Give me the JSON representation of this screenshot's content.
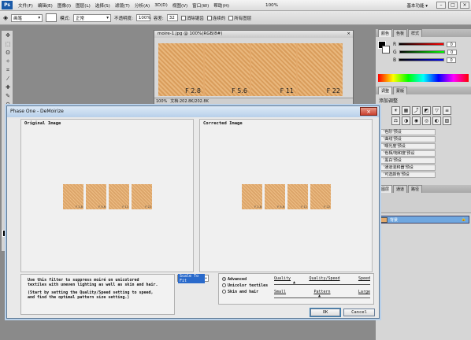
{
  "menubar": {
    "logo": "Ps",
    "items": [
      "文件(F)",
      "编辑(E)",
      "图像(I)",
      "图层(L)",
      "选择(S)",
      "滤镜(T)",
      "分析(A)",
      "3D(D)",
      "视图(V)",
      "窗口(W)",
      "帮助(H)"
    ],
    "zoom": "100%",
    "workspace": "基本功能 ▾"
  },
  "options": {
    "mode_preset": "画笔",
    "mode_label": "模式:",
    "mode_value": "正常",
    "opacity_label": "不透明度:",
    "opacity_value": "100%",
    "tolerance_label": "容差:",
    "tolerance_value": "32",
    "antialias_label": "消除锯齿",
    "contiguous_label": "连续的",
    "all_layers_label": "所有图层"
  },
  "document": {
    "title": "moire-1.jpg @ 100%(RGB/8#)",
    "panels": [
      "F 2.8",
      "F 5.6",
      "F 11",
      "F 22"
    ],
    "zoom": "100%",
    "doc_size": "文档:202.8K/202.8K"
  },
  "dialog": {
    "title": "Phase One - DeMoirize",
    "close_icon": "close-icon",
    "original_header": "Original Image",
    "corrected_header": "Corrected Image",
    "thumb_labels": [
      "F 2.8",
      "F 5.6",
      "F 11",
      "F 22"
    ],
    "description_line1": "Use this filter to suppress moiré on unicolored",
    "description_line2": "textiles with uneven lighting as well as skin and hair.",
    "description_line3": "(Start by setting the Quality/Speed setting to speed,",
    "description_line4": "and find the optimal pattern size setting.)",
    "scale_value": "Scale To Fit",
    "options": [
      "Advanced",
      "Unicolor textiles",
      "Skin and hair"
    ],
    "quality_label": "Quality",
    "quality_speed_label": "Quality/Speed",
    "speed_label": "Speed",
    "small_label": "Small",
    "pattern_label": "Pattern",
    "large_label": "Large",
    "ok_label": "OK",
    "cancel_label": "Cancel"
  },
  "panels": {
    "color_tabs": [
      "颜色",
      "色板",
      "样式"
    ],
    "color_values": [
      "R",
      "G",
      "B"
    ],
    "color_numbers": [
      "0",
      "0",
      "0"
    ],
    "adjust_tabs": [
      "调整",
      "蒙版"
    ],
    "adjust_title": "添加调整",
    "presets": [
      "'色阶'预设",
      "'曲线'预设",
      "'曝光度'预设",
      "'色相/饱和度'预设",
      "'黑白'预设",
      "'通道混和器'预设",
      "'可选颜色'预设"
    ],
    "layer_tabs": [
      "图层",
      "通道",
      "路径"
    ],
    "layer_name": "背景",
    "accent": "#6fa7e0"
  }
}
